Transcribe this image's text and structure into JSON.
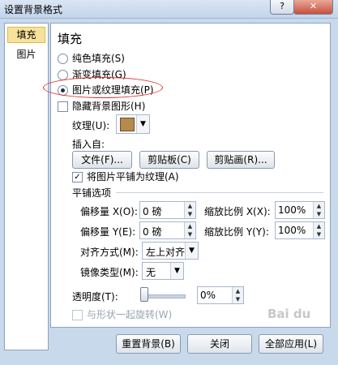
{
  "window": {
    "title": "设置背景格式",
    "help_glyph": "?",
    "close_glyph": "✕"
  },
  "tabs": [
    {
      "label": "填充"
    },
    {
      "label": "图片"
    }
  ],
  "fill": {
    "heading": "填充",
    "options": [
      {
        "label": "纯色填充(S)",
        "selected": false
      },
      {
        "label": "渐变填充(G)",
        "selected": false
      },
      {
        "label": "图片或纹理填充(P)",
        "selected": true
      }
    ],
    "hide_bg_graphics": {
      "label": "隐藏背景图形(H)",
      "checked": false
    },
    "texture_label": "纹理(U):",
    "insert_from_label": "插入自:",
    "insert_buttons": [
      "文件(F)...",
      "剪贴板(C)",
      "剪贴画(R)..."
    ],
    "tile_texture": {
      "label": "将图片平铺为纹理(A)",
      "checked": true
    },
    "tiling_heading": "平铺选项",
    "offset_x": {
      "label": "偏移量 X(O):",
      "value": "0 磅"
    },
    "offset_y": {
      "label": "偏移量 Y(E):",
      "value": "0 磅"
    },
    "scale_x": {
      "label": "缩放比例 X(X):",
      "value": "100%"
    },
    "scale_y": {
      "label": "缩放比例 Y(Y):",
      "value": "100%"
    },
    "alignment": {
      "label": "对齐方式(M):",
      "value": "左上对齐"
    },
    "mirror": {
      "label": "镜像类型(M):",
      "value": "无"
    },
    "transparency": {
      "label": "透明度(T):",
      "value": "0%",
      "level": 0
    },
    "rotate_with_shape": {
      "label": "与形状一起旋转(W)",
      "checked": false,
      "disabled": true
    }
  },
  "footer": {
    "reset": "重置背景(B)",
    "close": "关闭",
    "apply_all": "全部应用(L)"
  },
  "watermark": "Bai du"
}
